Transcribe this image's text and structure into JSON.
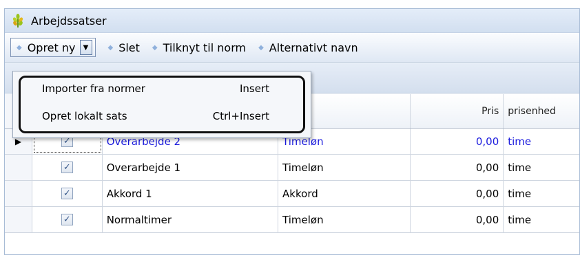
{
  "window": {
    "title": "Arbejdssatser",
    "icon": "wheat-icon"
  },
  "toolbar": {
    "create_new": {
      "label": "Opret ny"
    },
    "delete": {
      "label": "Slet"
    },
    "attach_norm": {
      "label": "Tilknyt til norm"
    },
    "alt_name": {
      "label": "Alternativt navn"
    }
  },
  "dropdown": {
    "items": [
      {
        "label": "Importer fra normer",
        "shortcut": "Insert"
      },
      {
        "label": "Opret lokalt sats",
        "shortcut": "Ctrl+Insert"
      }
    ]
  },
  "grid": {
    "columns": [
      "",
      "",
      "",
      "ype",
      "Pris",
      "prisenhed"
    ],
    "rows": [
      {
        "checked": true,
        "name": "Overarbejde 2",
        "type": "Timeløn",
        "price": "0,00",
        "unit": "time",
        "active": true
      },
      {
        "checked": true,
        "name": "Overarbejde 1",
        "type": "Timeløn",
        "price": "0,00",
        "unit": "time",
        "active": false
      },
      {
        "checked": true,
        "name": "Akkord 1",
        "type": "Akkord",
        "price": "0,00",
        "unit": "time",
        "active": false
      },
      {
        "checked": true,
        "name": "Normaltimer",
        "type": "Timeløn",
        "price": "0,00",
        "unit": "time",
        "active": false
      }
    ]
  },
  "colors": {
    "accent": "#1a1add",
    "bullet": "#8fb0dc",
    "titlebar": "#d2dff0"
  }
}
